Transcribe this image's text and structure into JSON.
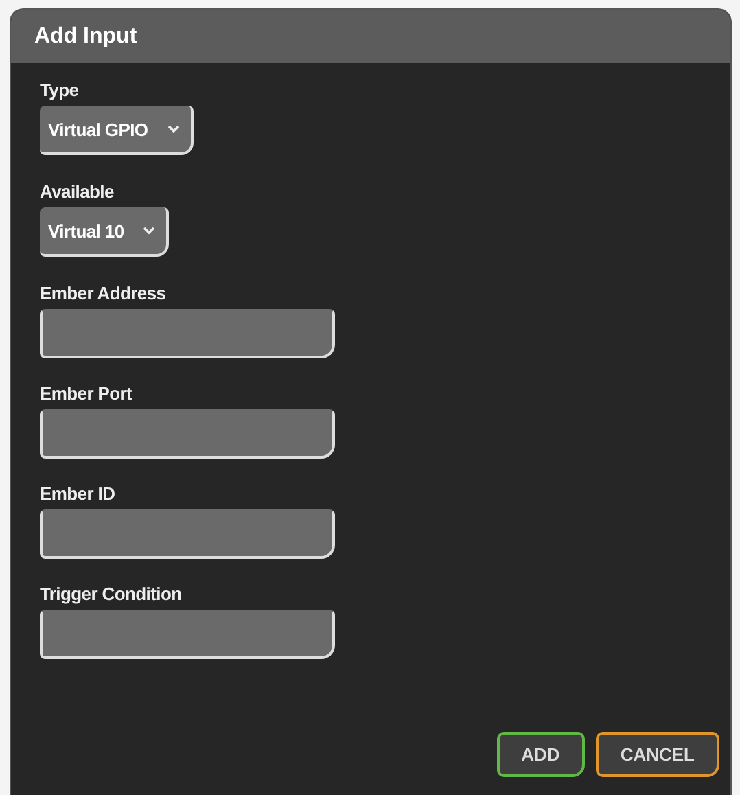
{
  "dialog": {
    "title": "Add Input"
  },
  "fields": [
    {
      "label": "Type",
      "kind": "select",
      "value": "Virtual GPIO"
    },
    {
      "label": "Available",
      "kind": "select",
      "value": "Virtual 10"
    },
    {
      "label": "Ember Address",
      "kind": "text"
    },
    {
      "label": "Ember Port",
      "kind": "text"
    },
    {
      "label": "Ember ID",
      "kind": "text"
    },
    {
      "label": "Trigger Condition",
      "kind": "text"
    }
  ],
  "buttons": [
    {
      "label": "ADD",
      "kind": "confirm"
    },
    {
      "label": "CANCEL",
      "kind": "cancel"
    }
  ]
}
